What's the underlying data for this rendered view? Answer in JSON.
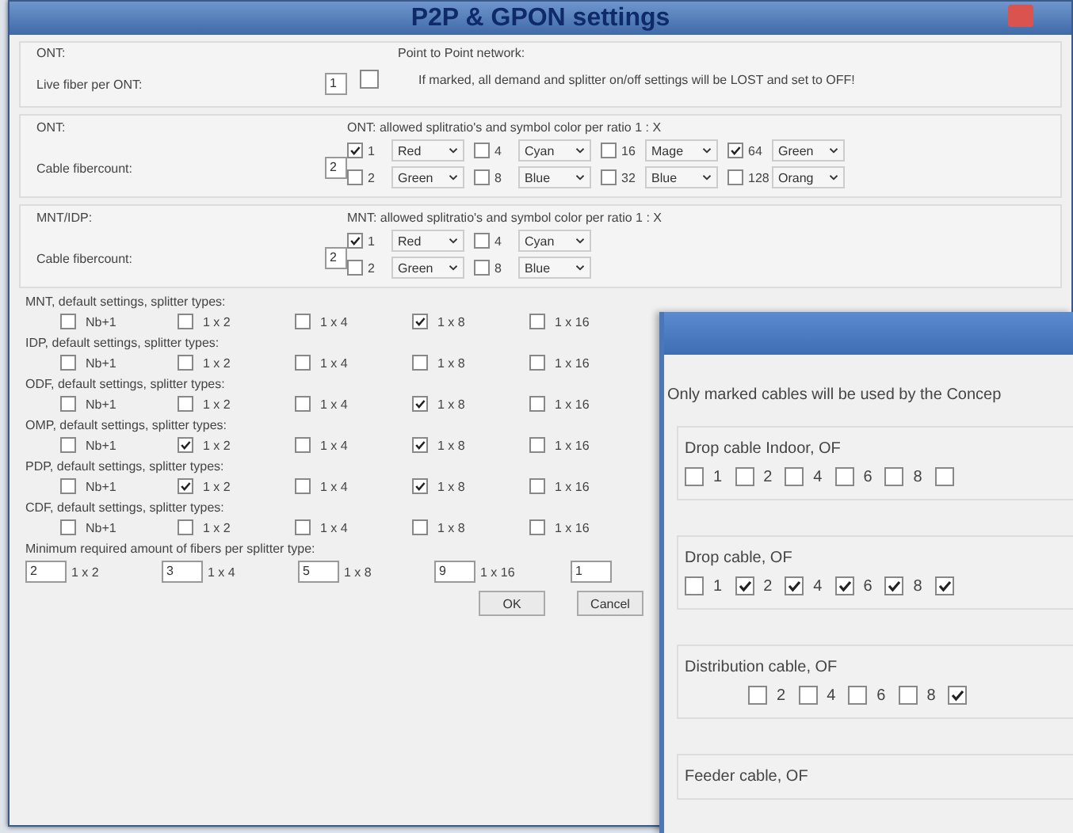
{
  "main_window": {
    "title": "P2P & GPON settings",
    "p2p": {
      "label": "ONT:",
      "field_label": "Live fiber per ONT:",
      "field_value": "1",
      "heading": "Point to Point network:",
      "checked": false,
      "warning": "If marked, all demand and splitter on/off settings will be LOST and set to OFF!"
    },
    "ratio_sections": [
      {
        "label": "ONT:",
        "field_label": "Cable fibercount:",
        "field_value": "2",
        "heading": "ONT: allowed splitratio's and symbol color per ratio 1 : X",
        "rows": [
          [
            {
              "ratio": "1",
              "checked": true,
              "color_choice": "Red"
            },
            {
              "ratio": "4",
              "checked": false,
              "color_choice": "Cyan"
            },
            {
              "ratio": "16",
              "checked": false,
              "color_choice": "Mage"
            },
            {
              "ratio": "64",
              "checked": true,
              "color_choice": "Green"
            }
          ],
          [
            {
              "ratio": "2",
              "checked": false,
              "color_choice": "Green"
            },
            {
              "ratio": "8",
              "checked": false,
              "color_choice": "Blue"
            },
            {
              "ratio": "32",
              "checked": false,
              "color_choice": "Blue"
            },
            {
              "ratio": "128",
              "checked": false,
              "color_choice": "Orang"
            }
          ]
        ]
      },
      {
        "label": "MNT/IDP:",
        "field_label": "Cable fibercount:",
        "field_value": "2",
        "heading": "MNT: allowed splitratio's and symbol color per ratio 1 : X",
        "rows": [
          [
            {
              "ratio": "1",
              "checked": true,
              "color_choice": "Red"
            },
            {
              "ratio": "4",
              "checked": false,
              "color_choice": "Cyan"
            }
          ],
          [
            {
              "ratio": "2",
              "checked": false,
              "color_choice": "Green"
            },
            {
              "ratio": "8",
              "checked": false,
              "color_choice": "Blue"
            }
          ]
        ]
      }
    ],
    "splitter_groups": [
      {
        "heading": "MNT, default settings, splitter types:",
        "options": [
          {
            "label": "Nb+1",
            "checked": false
          },
          {
            "label": "1 x 2",
            "checked": false
          },
          {
            "label": "1 x 4",
            "checked": false
          },
          {
            "label": "1 x 8",
            "checked": true
          },
          {
            "label": "1 x 16",
            "checked": false
          }
        ]
      },
      {
        "heading": "IDP, default settings, splitter types:",
        "options": [
          {
            "label": "Nb+1",
            "checked": false
          },
          {
            "label": "1 x 2",
            "checked": false
          },
          {
            "label": "1 x 4",
            "checked": false
          },
          {
            "label": "1 x 8",
            "checked": false
          },
          {
            "label": "1 x 16",
            "checked": false
          }
        ]
      },
      {
        "heading": "ODF, default settings, splitter types:",
        "options": [
          {
            "label": "Nb+1",
            "checked": false
          },
          {
            "label": "1 x 2",
            "checked": false
          },
          {
            "label": "1 x 4",
            "checked": false
          },
          {
            "label": "1 x 8",
            "checked": true
          },
          {
            "label": "1 x 16",
            "checked": false
          }
        ]
      },
      {
        "heading": "OMP, default settings, splitter types:",
        "options": [
          {
            "label": "Nb+1",
            "checked": false
          },
          {
            "label": "1 x 2",
            "checked": true
          },
          {
            "label": "1 x 4",
            "checked": false
          },
          {
            "label": "1 x 8",
            "checked": true
          },
          {
            "label": "1 x 16",
            "checked": false
          }
        ]
      },
      {
        "heading": "PDP, default settings, splitter types:",
        "options": [
          {
            "label": "Nb+1",
            "checked": false
          },
          {
            "label": "1 x 2",
            "checked": true
          },
          {
            "label": "1 x 4",
            "checked": false
          },
          {
            "label": "1 x 8",
            "checked": true
          },
          {
            "label": "1 x 16",
            "checked": false
          }
        ]
      },
      {
        "heading": "CDF, default settings, splitter types:",
        "options": [
          {
            "label": "Nb+1",
            "checked": false
          },
          {
            "label": "1 x 2",
            "checked": false
          },
          {
            "label": "1 x 4",
            "checked": false
          },
          {
            "label": "1 x 8",
            "checked": false
          },
          {
            "label": "1 x 16",
            "checked": false
          }
        ]
      }
    ],
    "minimum": {
      "heading": "Minimum required amount of fibers per splitter type:",
      "fields": [
        {
          "value": "2",
          "label": "1 x 2"
        },
        {
          "value": "3",
          "label": "1 x 4"
        },
        {
          "value": "5",
          "label": "1 x 8"
        },
        {
          "value": "9",
          "label": "1 x 16"
        },
        {
          "value": "1"
        }
      ]
    },
    "buttons": [
      "OK",
      "Cancel"
    ]
  },
  "cable_window": {
    "intro": "Only marked cables will be used by the Concep",
    "groups": [
      {
        "heading": "Drop cable Indoor, OF",
        "indented": false,
        "options": [
          {
            "label": "1",
            "checked": false
          },
          {
            "label": "2",
            "checked": false
          },
          {
            "label": "4",
            "checked": false
          },
          {
            "label": "6",
            "checked": false
          },
          {
            "label": "8",
            "checked": false
          },
          {
            "checked": false
          }
        ]
      },
      {
        "heading": "Drop cable, OF",
        "indented": false,
        "options": [
          {
            "label": "1",
            "checked": false
          },
          {
            "label": "2",
            "checked": true
          },
          {
            "label": "4",
            "checked": true
          },
          {
            "label": "6",
            "checked": true
          },
          {
            "label": "8",
            "checked": true
          },
          {
            "checked": true
          }
        ]
      },
      {
        "heading": "Distribution cable, OF",
        "indented": true,
        "options": [
          {
            "label": "2",
            "checked": false
          },
          {
            "label": "4",
            "checked": false
          },
          {
            "label": "6",
            "checked": false
          },
          {
            "label": "8",
            "checked": false
          },
          {
            "checked": true
          }
        ]
      },
      {
        "heading": "Feeder cable, OF"
      }
    ]
  }
}
